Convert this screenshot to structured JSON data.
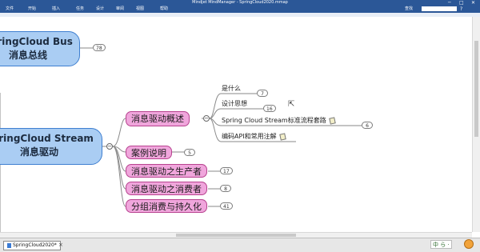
{
  "window": {
    "title": "Mindjet MindManager - SpringCloud2020.mmap",
    "minimize": "─",
    "maximize": "□",
    "close": "✕"
  },
  "menu": {
    "items": [
      "文件",
      "开始",
      "插入",
      "任务",
      "设计",
      "审阅",
      "视图",
      "帮助"
    ],
    "search_label": "查找",
    "help_glyph": "?"
  },
  "map": {
    "bus_node": {
      "line1": "SpringCloud Bus",
      "line2": "消息总线",
      "count": "78"
    },
    "stream_node": {
      "line1": "SpringCloud Stream",
      "line2": "消息驱动"
    },
    "topics": [
      {
        "label": "消息驱动概述",
        "subtopics": [
          {
            "label": "是什么",
            "count": "7"
          },
          {
            "label": "设计思想",
            "count": "16"
          },
          {
            "label": "Spring Cloud Stream标准流程套路",
            "count": "6"
          },
          {
            "label": "编码API和常用注解",
            "count": ""
          }
        ]
      },
      {
        "label": "案例说明",
        "count": "5"
      },
      {
        "label": "消息驱动之生产者",
        "count": "17"
      },
      {
        "label": "消息驱动之消费者",
        "count": "8"
      },
      {
        "label": "分组消费与持久化",
        "count": "41"
      }
    ],
    "collapse_glyph": "−"
  },
  "tabs": {
    "doc_tab": "SpringCloud2020*",
    "close_glyph": "×"
  },
  "tray": {
    "ime": "中 ら ·"
  }
}
